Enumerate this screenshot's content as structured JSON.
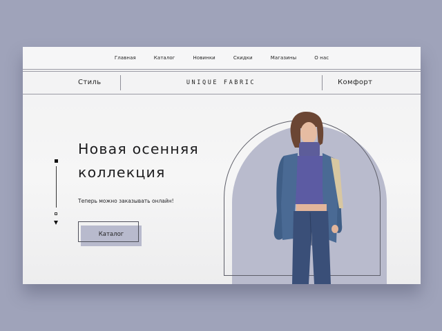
{
  "nav": {
    "items": [
      "Главная",
      "Каталог",
      "Новинки",
      "Скидки",
      "Магазины",
      "О нас"
    ]
  },
  "subbar": {
    "left_label": "Стиль",
    "logo": "UNIQUE FABRIC",
    "right_label": "Комфорт"
  },
  "hero": {
    "headline_line1": "Новая осенняя",
    "headline_line2": "коллекция",
    "subtext": "Теперь можно заказывать онлайн!",
    "button_label": "Каталог"
  },
  "colors": {
    "background": "#9fa3ba",
    "accent": "#b9bbcd",
    "text": "#1d1d1f"
  },
  "icons": [
    "slider-current-dot-icon",
    "slider-dot-icon",
    "scroll-down-arrow-icon"
  ]
}
